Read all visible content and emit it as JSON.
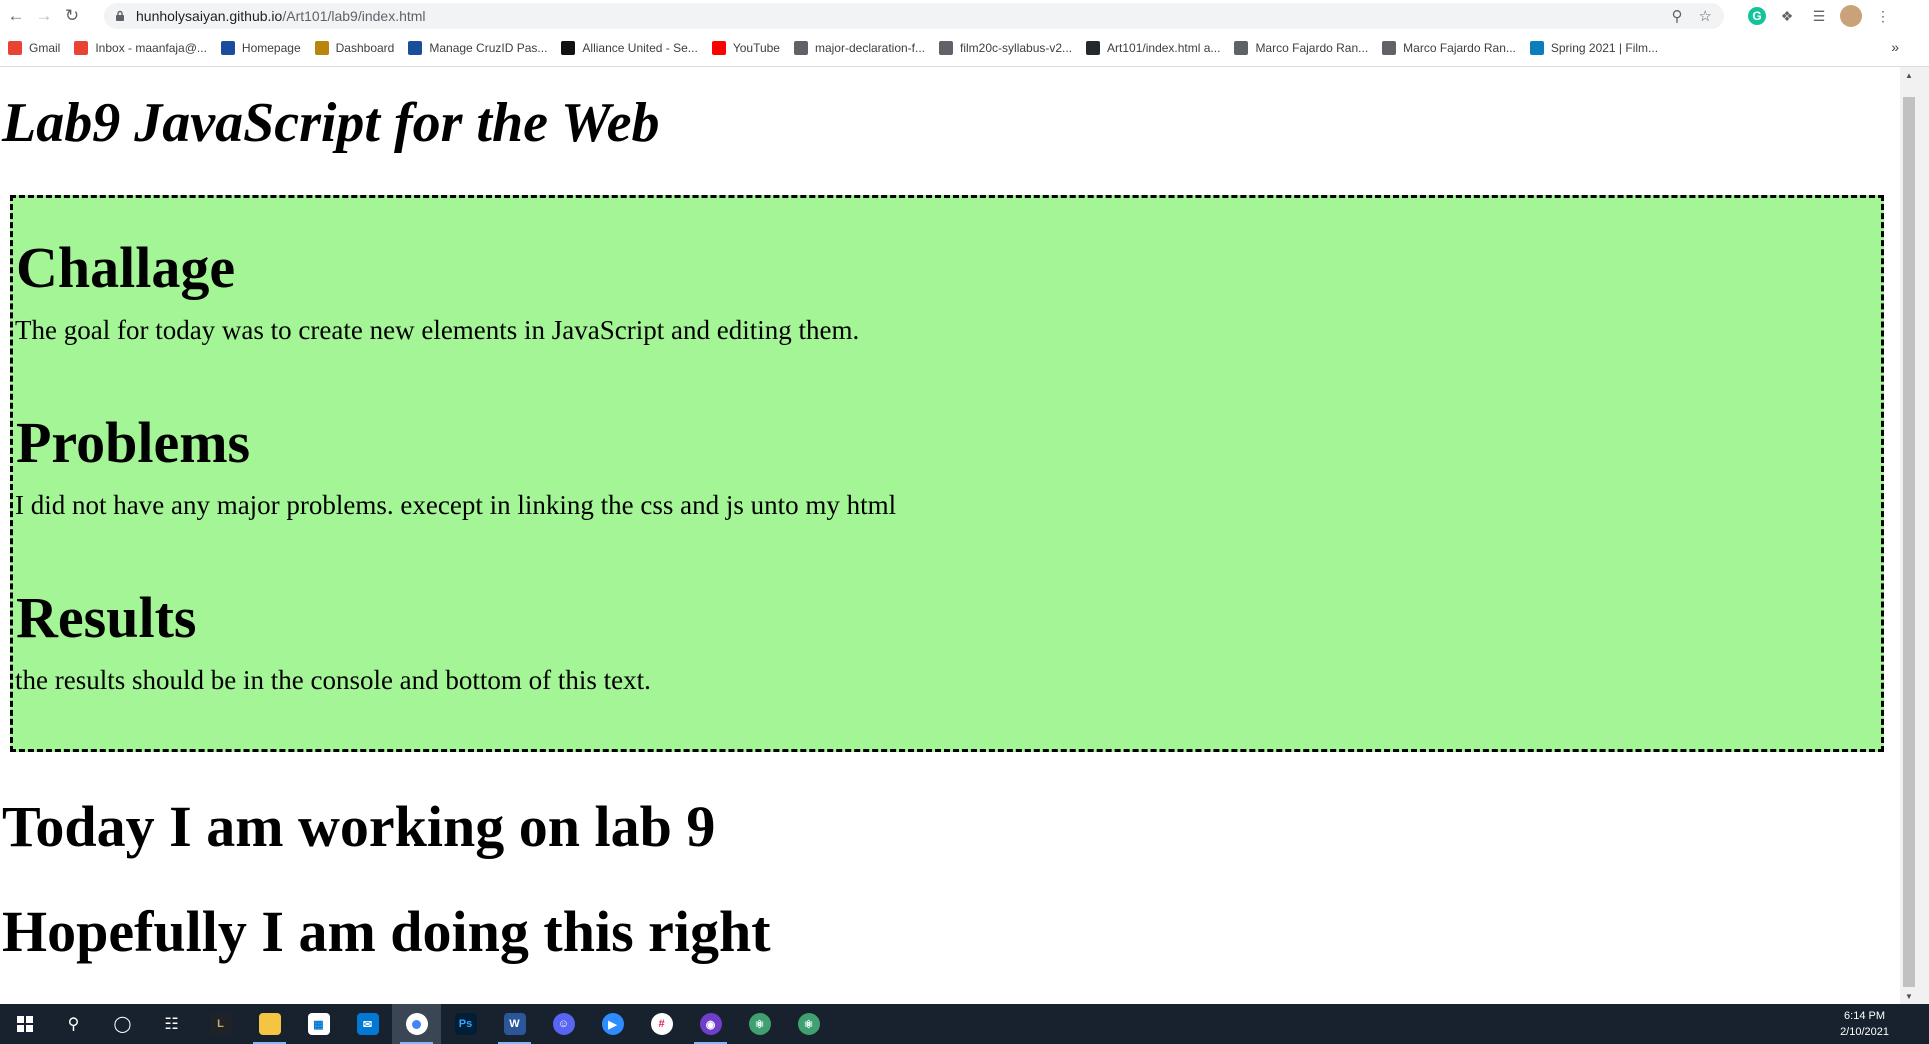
{
  "browser": {
    "url_host": "hunholysaiyan.github.io",
    "url_path": "/Art101/lab9/index.html",
    "bookmarks": [
      {
        "label": "Gmail",
        "icon": "gmail-icon",
        "color": "#ea4335"
      },
      {
        "label": "Inbox - maanfaja@...",
        "icon": "gmail-icon",
        "color": "#ea4335"
      },
      {
        "label": "Homepage",
        "icon": "homepage-icon",
        "color": "#1a4e9c"
      },
      {
        "label": "Dashboard",
        "icon": "dashboard-icon",
        "color": "#b8860b"
      },
      {
        "label": "Manage CruzID Pas...",
        "icon": "ucsc-icon",
        "color": "#1a4e9c"
      },
      {
        "label": "Alliance United - Se...",
        "icon": "k-icon",
        "color": "#111111"
      },
      {
        "label": "YouTube",
        "icon": "youtube-icon",
        "color": "#ff0000"
      },
      {
        "label": "major-declaration-f...",
        "icon": "globe-icon",
        "color": "#5f6368"
      },
      {
        "label": "film20c-syllabus-v2...",
        "icon": "globe-icon",
        "color": "#5f6368"
      },
      {
        "label": "Art101/index.html a...",
        "icon": "github-icon",
        "color": "#24292e"
      },
      {
        "label": "Marco Fajardo Ran...",
        "icon": "globe-icon",
        "color": "#5f6368"
      },
      {
        "label": "Marco Fajardo Ran...",
        "icon": "globe-icon",
        "color": "#5f6368"
      },
      {
        "label": "Spring 2021 | Film...",
        "icon": "edge-icon",
        "color": "#0f7dbd"
      }
    ],
    "bookmarks_more": "»"
  },
  "page": {
    "title": "Lab9 JavaScript for the Web",
    "sections": [
      {
        "heading": "Challage",
        "text": "The goal for today was to create new elements in JavaScript and editing them."
      },
      {
        "heading": "Problems",
        "text": "I did not have any major problems. execept in linking the css and js unto my html"
      },
      {
        "heading": "Results",
        "text": "the results should be in the console and bottom of this text."
      }
    ],
    "lines": [
      "Today I am working on lab 9",
      "Hopefully I am doing this right"
    ],
    "box_color": "#a3f596"
  },
  "taskbar": {
    "time": "6:14 PM",
    "date": "2/10/2021"
  }
}
